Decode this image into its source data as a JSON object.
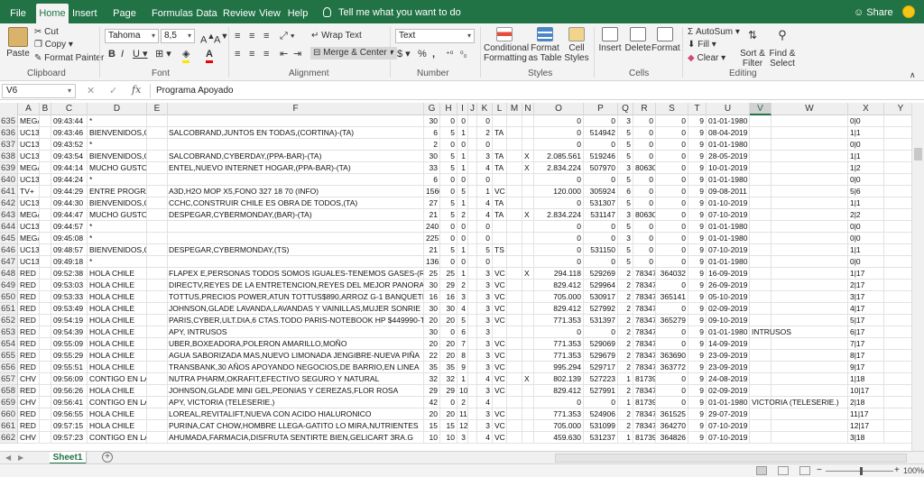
{
  "tabs": [
    {
      "label": "File"
    },
    {
      "label": "Home"
    },
    {
      "label": "Insert"
    },
    {
      "label": "Page Layout"
    },
    {
      "label": "Formulas"
    },
    {
      "label": "Data"
    },
    {
      "label": "Review"
    },
    {
      "label": "View"
    },
    {
      "label": "Help"
    }
  ],
  "tell_me": "Tell me what you want to do",
  "share": "Share",
  "ribbon": {
    "clipboard": {
      "paste": "Paste",
      "cut": "Cut",
      "copy": "Copy",
      "format_painter": "Format Painter",
      "label": "Clipboard"
    },
    "font": {
      "name": "Tahoma",
      "size": "8,5",
      "label": "Font"
    },
    "alignment": {
      "wrap": "Wrap Text",
      "merge": "Merge & Center",
      "label": "Alignment"
    },
    "number": {
      "format": "Text",
      "label": "Number"
    },
    "styles": {
      "conditional": "Conditional Formatting",
      "format_table": "Format as Table",
      "cell_styles": "Cell Styles",
      "label": "Styles"
    },
    "cells": {
      "insert": "Insert",
      "delete": "Delete",
      "format": "Format",
      "label": "Cells"
    },
    "editing": {
      "autosum": "AutoSum",
      "fill": "Fill",
      "clear": "Clear",
      "sort": "Sort & Filter",
      "find": "Find & Select",
      "label": "Editing"
    }
  },
  "name_box": "V6",
  "formula": "Programa Apoyado",
  "columns": [
    "A",
    "B",
    "C",
    "D",
    "E",
    "F",
    "G",
    "H",
    "I",
    "J",
    "K",
    "L",
    "M",
    "N",
    "O",
    "P",
    "Q",
    "R",
    "S",
    "T",
    "U",
    "V",
    "W",
    "X",
    "Y",
    "Z"
  ],
  "selected_column": "V",
  "rows": [
    [
      "635",
      "MEGA",
      "09:43:44",
      "*",
      "",
      "30",
      "0",
      "0",
      "0",
      "",
      "",
      "0",
      "0",
      "3",
      "0",
      "0",
      "9",
      "01-01-1980",
      "",
      "0|0"
    ],
    [
      "636",
      "UC13",
      "09:43:46",
      "BIENVENIDOS,CADA UNO",
      "SALCOBRAND,JUNTOS EN TODAS,(CORTINA)-(TA)",
      "6",
      "5",
      "1",
      "2",
      "TA",
      "",
      "0",
      "514942",
      "5",
      "0",
      "0",
      "9",
      "08-04-2019",
      "",
      "1|1"
    ],
    [
      "637",
      "UC13",
      "09:43:52",
      "*",
      "",
      "2",
      "0",
      "0",
      "0",
      "",
      "",
      "0",
      "0",
      "5",
      "0",
      "0",
      "9",
      "01-01-1980",
      "",
      "0|0"
    ],
    [
      "638",
      "UC13",
      "09:43:54",
      "BIENVENIDOS,CADA UNO",
      "SALCOBRAND,CYBERDAY,(PPA-BAR)-(TA)",
      "30",
      "5",
      "1",
      "3",
      "TA",
      "X",
      "2.085.561",
      "519246",
      "5",
      "0",
      "0",
      "9",
      "28-05-2019",
      "",
      "1|1"
    ],
    [
      "639",
      "MEGA",
      "09:44:14",
      "MUCHO GUSTO TE LEVAN",
      "ENTEL,NUEVO INTERNET HOGAR,(PPA-BAR)-(TA)",
      "33",
      "5",
      "1",
      "4",
      "TA",
      "X",
      "2.834.224",
      "507970",
      "3",
      "80630",
      "0",
      "9",
      "10-01-2019",
      "",
      "1|2"
    ],
    [
      "640",
      "UC13",
      "09:44:24",
      "*",
      "",
      "6",
      "0",
      "0",
      "0",
      "",
      "",
      "0",
      "0",
      "5",
      "0",
      "0",
      "9",
      "01-01-1980",
      "",
      "0|0"
    ],
    [
      "641",
      "TV+",
      "09:44:29",
      "ENTRE PROGRAMAS",
      "A3D,H2O MOP X5,FONO 327 18 70 (INFO)",
      "1560",
      "0",
      "5",
      "1",
      "VC",
      "",
      "120.000",
      "305924",
      "6",
      "0",
      "0",
      "9",
      "09-08-2011",
      "",
      "5|6"
    ],
    [
      "642",
      "UC13",
      "09:44:30",
      "BIENVENIDOS,CADA UNO",
      "CCHC,CONSTRUIR CHILE ES OBRA DE TODOS,(TA)",
      "27",
      "5",
      "1",
      "4",
      "TA",
      "",
      "0",
      "531307",
      "5",
      "0",
      "0",
      "9",
      "01-10-2019",
      "",
      "1|1"
    ],
    [
      "643",
      "MEGA",
      "09:44:47",
      "MUCHO GUSTO TE LEVAN",
      "DESPEGAR,CYBERMONDAY,(BAR)-(TA)",
      "21",
      "5",
      "2",
      "4",
      "TA",
      "X",
      "2.834.224",
      "531147",
      "3",
      "80630",
      "0",
      "9",
      "07-10-2019",
      "",
      "2|2"
    ],
    [
      "644",
      "UC13",
      "09:44:57",
      "*",
      "",
      "240",
      "0",
      "0",
      "0",
      "",
      "",
      "0",
      "0",
      "5",
      "0",
      "0",
      "9",
      "01-01-1980",
      "",
      "0|0"
    ],
    [
      "645",
      "MEGA",
      "09:45:08",
      "*",
      "",
      "2257",
      "0",
      "0",
      "0",
      "",
      "",
      "0",
      "0",
      "3",
      "0",
      "0",
      "9",
      "01-01-1980",
      "",
      "0|0"
    ],
    [
      "646",
      "UC13",
      "09:48:57",
      "BIENVENIDOS,CADA UNO",
      "DESPEGAR,CYBERMONDAY,(TS)",
      "21",
      "5",
      "1",
      "5",
      "TS",
      "",
      "0",
      "531150",
      "5",
      "0",
      "0",
      "9",
      "07-10-2019",
      "",
      "1|1"
    ],
    [
      "647",
      "UC13",
      "09:49:18",
      "*",
      "",
      "1361",
      "0",
      "0",
      "0",
      "",
      "",
      "0",
      "0",
      "5",
      "0",
      "0",
      "9",
      "01-01-1980",
      "",
      "0|0"
    ],
    [
      "648",
      "RED",
      "09:52:38",
      "HOLA CHILE",
      "FLAPEX E,PERSONAS TODOS SOMOS IGUALES-TENEMOS GASES-(RED)",
      "25",
      "25",
      "1",
      "3",
      "VC",
      "X",
      "294.118",
      "529269",
      "2",
      "78347",
      "364032",
      "9",
      "16-09-2019",
      "",
      "1|17"
    ],
    [
      "649",
      "RED",
      "09:53:03",
      "HOLA CHILE",
      "DIRECTV,REYES DE LA ENTRETENCION,REYES DEL MEJOR PANORAMA",
      "30",
      "29",
      "2",
      "3",
      "VC",
      "",
      "829.412",
      "529964",
      "2",
      "78347",
      "0",
      "9",
      "26-09-2019",
      "",
      "2|17"
    ],
    [
      "650",
      "RED",
      "09:53:33",
      "HOLA CHILE",
      "TOTTUS,PRECIOS POWER,ATUN TOTTUS$890,ARROZ G-1 BANQUETE $990",
      "16",
      "16",
      "3",
      "3",
      "VC",
      "",
      "705.000",
      "530917",
      "2",
      "78347",
      "365141",
      "9",
      "05-10-2019",
      "",
      "3|17"
    ],
    [
      "651",
      "RED",
      "09:53:49",
      "HOLA CHILE",
      "JOHNSON,GLADE LAVANDA,LAVANDAS Y VAINILLAS,MUJER SONRIE",
      "30",
      "30",
      "4",
      "3",
      "VC",
      "",
      "829.412",
      "527992",
      "2",
      "78347",
      "0",
      "9",
      "02-09-2019",
      "",
      "4|17"
    ],
    [
      "652",
      "RED",
      "09:54:19",
      "HOLA CHILE",
      "PARIS,CYBER,ULT.DIA,6 CTAS.TODO PARIS-NOTEBOOK HP $449990-TJ",
      "20",
      "20",
      "5",
      "3",
      "VC",
      "",
      "771.353",
      "531397",
      "2",
      "78347",
      "365279",
      "9",
      "09-10-2019",
      "",
      "5|17"
    ],
    [
      "653",
      "RED",
      "09:54:39",
      "HOLA CHILE",
      "APY, INTRUSOS",
      "30",
      "0",
      "6",
      "3",
      "",
      "",
      "0",
      "0",
      "2",
      "78347",
      "0",
      "9",
      "01-01-1980",
      "INTRUSOS",
      "6|17"
    ],
    [
      "654",
      "RED",
      "09:55:09",
      "HOLA CHILE",
      "UBER,BOXEADORA,POLERON AMARILLO,MOÑO",
      "20",
      "20",
      "7",
      "3",
      "VC",
      "",
      "771.353",
      "529069",
      "2",
      "78347",
      "0",
      "9",
      "14-09-2019",
      "",
      "7|17"
    ],
    [
      "655",
      "RED",
      "09:55:29",
      "HOLA CHILE",
      "AGUA SABORIZADA MAS,NUEVO LIMONADA JENGIBRE-NUEVA PIÑA",
      "22",
      "20",
      "8",
      "3",
      "VC",
      "",
      "771.353",
      "529679",
      "2",
      "78347",
      "363690",
      "9",
      "23-09-2019",
      "",
      "8|17"
    ],
    [
      "656",
      "RED",
      "09:55:51",
      "HOLA CHILE",
      "TRANSBANK,30 AÑOS APOYANDO NEGOCIOS,DE BARRIO,EN LINEA",
      "35",
      "35",
      "9",
      "3",
      "VC",
      "",
      "995.294",
      "529717",
      "2",
      "78347",
      "363772",
      "9",
      "23-09-2019",
      "",
      "9|17"
    ],
    [
      "657",
      "CHV",
      "09:56:09",
      "CONTIGO EN LA MAÑANA",
      "NUTRA PHARM,OKRAFIT,EFECTIVO SEGURO Y NATURAL",
      "32",
      "32",
      "1",
      "4",
      "VC",
      "X",
      "802.139",
      "527223",
      "1",
      "81739",
      "0",
      "9",
      "24-08-2019",
      "",
      "1|18"
    ],
    [
      "658",
      "RED",
      "09:56:26",
      "HOLA CHILE",
      "JOHNSON,GLADE MINI GEL,PEONIAS Y CEREZAS,FLOR ROSA",
      "29",
      "29",
      "10",
      "3",
      "VC",
      "",
      "829.412",
      "527991",
      "2",
      "78347",
      "0",
      "9",
      "02-09-2019",
      "",
      "10|17"
    ],
    [
      "659",
      "CHV",
      "09:56:41",
      "CONTIGO EN LA MAÑANA",
      "APY, VICTORIA (TELESERIE.)",
      "42",
      "0",
      "2",
      "4",
      "",
      "",
      "0",
      "0",
      "1",
      "81739",
      "0",
      "9",
      "01-01-1980",
      "VICTORIA (TELESERIE.)",
      "2|18"
    ],
    [
      "660",
      "RED",
      "09:56:55",
      "HOLA CHILE",
      "LOREAL,REVITALIFT,NUEVA CON ACIDO HIALURONICO",
      "20",
      "20",
      "11",
      "3",
      "VC",
      "",
      "771.353",
      "524906",
      "2",
      "78347",
      "361525",
      "9",
      "29-07-2019",
      "",
      "11|17"
    ],
    [
      "661",
      "RED",
      "09:57:15",
      "HOLA CHILE",
      "PURINA,CAT CHOW,HOMBRE LLEGA-GATITO LO MIRA,NUTRIENTES",
      "15",
      "15",
      "12",
      "3",
      "VC",
      "",
      "705.000",
      "531099",
      "2",
      "78347",
      "364270",
      "9",
      "07-10-2019",
      "",
      "12|17"
    ],
    [
      "662",
      "CHV",
      "09:57:23",
      "CONTIGO EN LA MAÑANA",
      "AHUMADA,FARMACIA,DISFRUTA SENTIRTE BIEN,GELICART 3RA.G",
      "10",
      "10",
      "3",
      "4",
      "VC",
      "",
      "459.630",
      "531237",
      "1",
      "81739",
      "364826",
      "9",
      "07-10-2019",
      "",
      "3|18"
    ]
  ],
  "sheet_tab": "Sheet1",
  "zoom": "100%"
}
